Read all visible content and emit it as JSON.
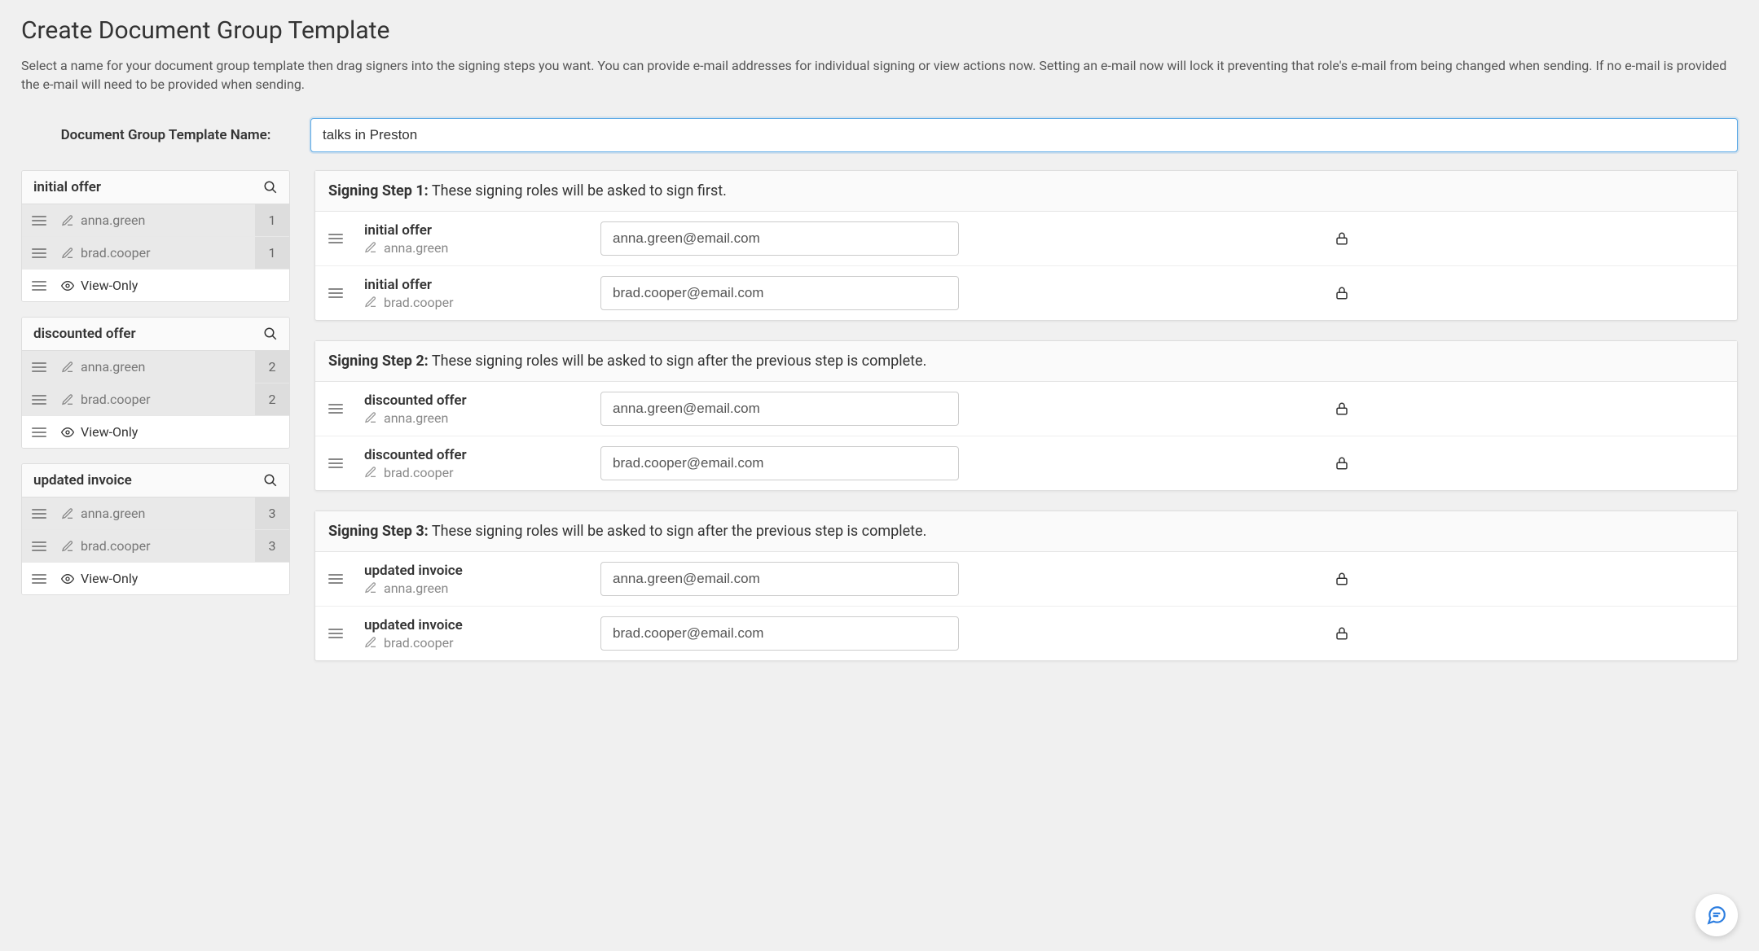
{
  "page": {
    "title": "Create Document Group Template",
    "description": "Select a name for your document group template then drag signers into the signing steps you want. You can provide e-mail addresses for individual signing or view actions now. Setting an e-mail now will lock it preventing that role's e-mail from being changed when sending. If no e-mail is provided the e-mail will need to be provided when sending."
  },
  "template_name": {
    "label": "Document Group Template Name:",
    "value": "talks in Preston"
  },
  "documents": [
    {
      "title": "initial offer",
      "roles": [
        {
          "name": "anna.green",
          "step": "1"
        },
        {
          "name": "brad.cooper",
          "step": "1"
        }
      ],
      "view_only_label": "View-Only"
    },
    {
      "title": "discounted offer",
      "roles": [
        {
          "name": "anna.green",
          "step": "2"
        },
        {
          "name": "brad.cooper",
          "step": "2"
        }
      ],
      "view_only_label": "View-Only"
    },
    {
      "title": "updated invoice",
      "roles": [
        {
          "name": "anna.green",
          "step": "3"
        },
        {
          "name": "brad.cooper",
          "step": "3"
        }
      ],
      "view_only_label": "View-Only"
    }
  ],
  "steps": [
    {
      "label_prefix": "Signing Step 1:",
      "label_rest": " These signing roles will be asked to sign first.",
      "rows": [
        {
          "doc": "initial offer",
          "role": "anna.green",
          "email": "anna.green@email.com"
        },
        {
          "doc": "initial offer",
          "role": "brad.cooper",
          "email": "brad.cooper@email.com"
        }
      ]
    },
    {
      "label_prefix": "Signing Step 2:",
      "label_rest": " These signing roles will be asked to sign after the previous step is complete.",
      "rows": [
        {
          "doc": "discounted offer",
          "role": "anna.green",
          "email": "anna.green@email.com"
        },
        {
          "doc": "discounted offer",
          "role": "brad.cooper",
          "email": "brad.cooper@email.com"
        }
      ]
    },
    {
      "label_prefix": "Signing Step 3:",
      "label_rest": " These signing roles will be asked to sign after the previous step is complete.",
      "rows": [
        {
          "doc": "updated invoice",
          "role": "anna.green",
          "email": "anna.green@email.com"
        },
        {
          "doc": "updated invoice",
          "role": "brad.cooper",
          "email": "brad.cooper@email.com"
        }
      ]
    }
  ]
}
